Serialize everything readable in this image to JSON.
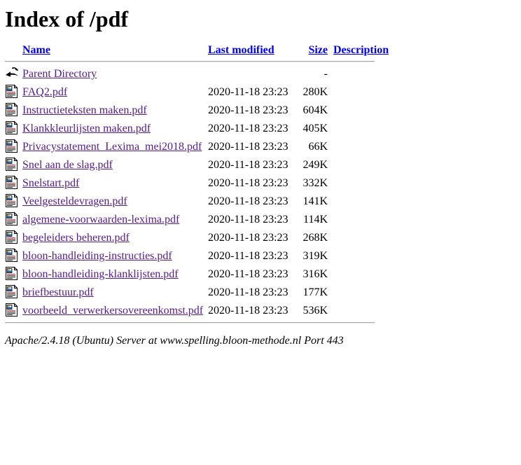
{
  "page": {
    "title": "Index of /pdf"
  },
  "table": {
    "headers": {
      "name": "Name",
      "last_modified": "Last modified",
      "size": "Size",
      "description": "Description"
    },
    "parent": {
      "icon": "back-arrow-icon",
      "label": "Parent Directory",
      "last_modified": "",
      "size": "-",
      "description": ""
    },
    "rows": [
      {
        "icon": "pdf-file-icon",
        "name": "FAQ2.pdf",
        "last_modified": "2020-11-18 23:23",
        "size": "280K",
        "description": ""
      },
      {
        "icon": "pdf-file-icon",
        "name": "Instructieteksten maken.pdf",
        "last_modified": "2020-11-18 23:23",
        "size": "604K",
        "description": ""
      },
      {
        "icon": "pdf-file-icon",
        "name": "Klankkleurlijsten maken.pdf",
        "last_modified": "2020-11-18 23:23",
        "size": "405K",
        "description": ""
      },
      {
        "icon": "pdf-file-icon",
        "name": "Privacystatement_Lexima_mei2018.pdf",
        "last_modified": "2020-11-18 23:23",
        "size": "66K",
        "description": ""
      },
      {
        "icon": "pdf-file-icon",
        "name": "Snel aan de slag.pdf",
        "last_modified": "2020-11-18 23:23",
        "size": "249K",
        "description": ""
      },
      {
        "icon": "pdf-file-icon",
        "name": "Snelstart.pdf",
        "last_modified": "2020-11-18 23:23",
        "size": "332K",
        "description": ""
      },
      {
        "icon": "pdf-file-icon",
        "name": "Veelgesteldevragen.pdf",
        "last_modified": "2020-11-18 23:23",
        "size": "141K",
        "description": ""
      },
      {
        "icon": "pdf-file-icon",
        "name": "algemene-voorwaarden-lexima.pdf",
        "last_modified": "2020-11-18 23:23",
        "size": "114K",
        "description": ""
      },
      {
        "icon": "pdf-file-icon",
        "name": "begeleiders beheren.pdf",
        "last_modified": "2020-11-18 23:23",
        "size": "268K",
        "description": ""
      },
      {
        "icon": "pdf-file-icon",
        "name": "bloon-handleiding-instructies.pdf",
        "last_modified": "2020-11-18 23:23",
        "size": "319K",
        "description": ""
      },
      {
        "icon": "pdf-file-icon",
        "name": "bloon-handleiding-klanklijsten.pdf",
        "last_modified": "2020-11-18 23:23",
        "size": "316K",
        "description": ""
      },
      {
        "icon": "pdf-file-icon",
        "name": "briefbestuur.pdf",
        "last_modified": "2020-11-18 23:23",
        "size": "177K",
        "description": ""
      },
      {
        "icon": "pdf-file-icon",
        "name": "voorbeeld_verwerkersovereenkomst.pdf",
        "last_modified": "2020-11-18 23:23",
        "size": "536K",
        "description": ""
      }
    ]
  },
  "footer": {
    "server_signature": "Apache/2.4.18 (Ubuntu) Server at www.spelling.bloon-methode.nl Port 443"
  },
  "colors": {
    "link_visited": "#551a8b",
    "link_unvisited": "#0000ee",
    "text": "#000000",
    "rule": "#a9a9a9",
    "background": "#ffffff"
  }
}
